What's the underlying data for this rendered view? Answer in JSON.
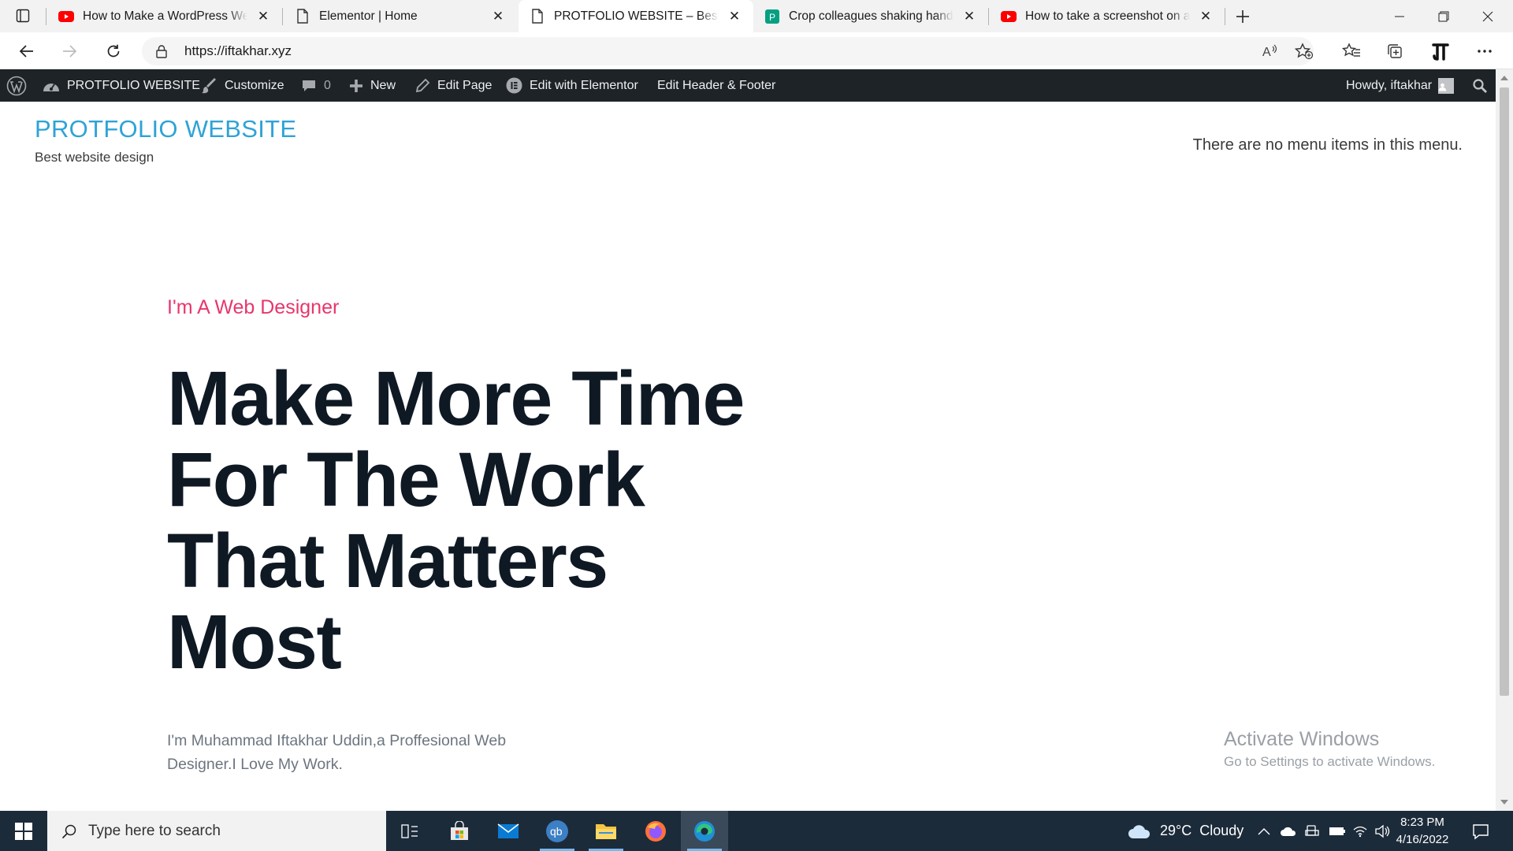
{
  "browser": {
    "tabs": [
      {
        "title": "How to Make a WordPress Website",
        "icon": "youtube-icon",
        "active": false
      },
      {
        "title": "Elementor | Home",
        "icon": "page-icon",
        "active": false
      },
      {
        "title": "PROTFOLIO WEBSITE – Best website design",
        "icon": "page-icon",
        "active": true
      },
      {
        "title": "Crop colleagues shaking hands in office",
        "icon": "pexels-icon",
        "active": false
      },
      {
        "title": "How to take a screenshot on a PC",
        "icon": "youtube-icon",
        "active": false
      }
    ],
    "url": "https://iftakhar.xyz"
  },
  "wp_admin_bar": {
    "site_name": "PROTFOLIO WEBSITE",
    "customize": "Customize",
    "comments_count": "0",
    "new": "New",
    "edit_page": "Edit Page",
    "edit_with_elementor": "Edit with Elementor",
    "edit_header_footer": "Edit Header & Footer",
    "howdy": "Howdy, iftakhar"
  },
  "site": {
    "title": "PROTFOLIO WEBSITE",
    "tagline": "Best website design",
    "menu_note": "There are no menu items in this menu."
  },
  "hero": {
    "eyebrow": "I'm A Web Designer",
    "heading": "Make More Time For The Work That Matters Most",
    "intro": "I'm Muhammad Iftakhar Uddin,a Proffesional Web Designer.I Love My Work."
  },
  "watermark": {
    "line1": "Activate Windows",
    "line2": "Go to Settings to activate Windows."
  },
  "taskbar": {
    "search_placeholder": "Type here to search",
    "weather": "29°C  Cloudy",
    "time": "8:23 PM",
    "date": "4/16/2022"
  },
  "colors": {
    "site_title": "#2ea3d6",
    "eyebrow": "#e8366b",
    "hero_text": "#0f1924",
    "wp_bar": "#1d2327",
    "taskbar": "#1c2b3a"
  }
}
